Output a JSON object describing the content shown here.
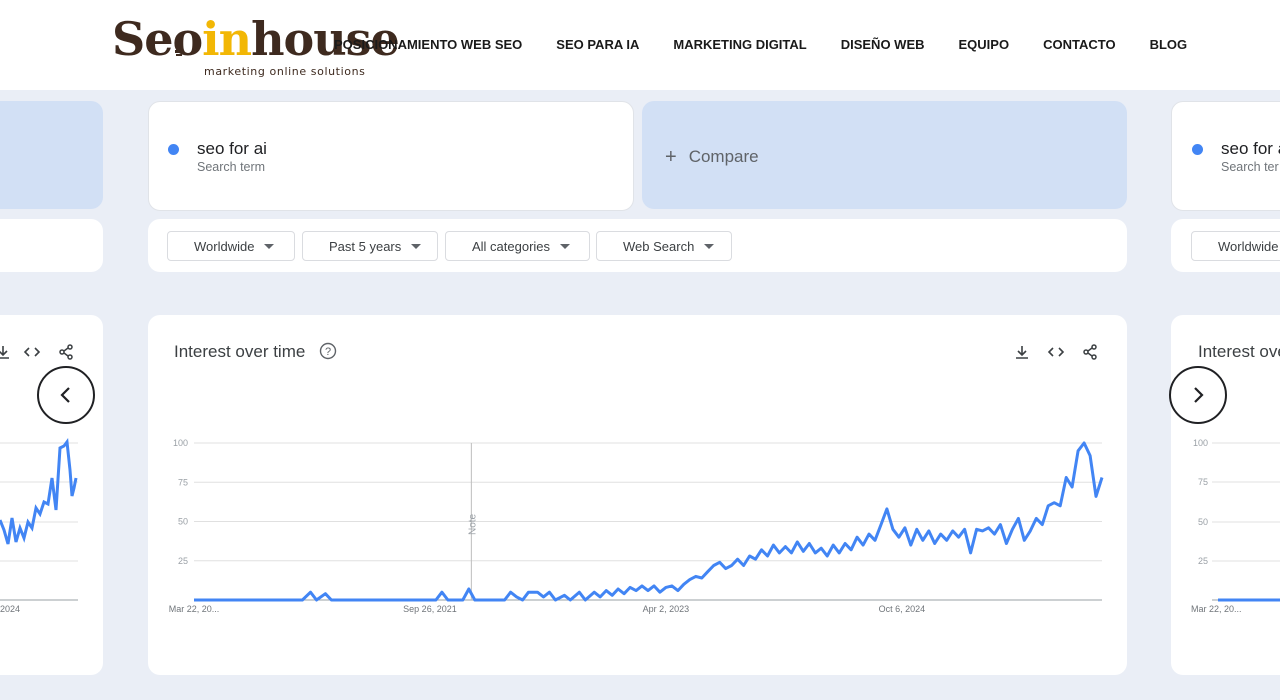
{
  "site": {
    "logo_parts": {
      "a": "Seo",
      "b": "in",
      "c": "house"
    },
    "tagline": "marketing online solutions",
    "nav": [
      {
        "label": "POSICIONAMIENTO WEB SEO"
      },
      {
        "label": "SEO PARA IA"
      },
      {
        "label": "MARKETING DIGITAL"
      },
      {
        "label": "DISEÑO WEB"
      },
      {
        "label": "EQUIPO"
      },
      {
        "label": "CONTACTO"
      },
      {
        "label": "BLOG"
      }
    ]
  },
  "trends": {
    "term": {
      "name": "seo for ai",
      "sub": "Search term",
      "color": "#4285f4"
    },
    "right_term": {
      "name": "seo for a",
      "sub": "Search ter"
    },
    "compare_label": "Compare",
    "filters": {
      "region": "Worldwide",
      "time": "Past 5 years",
      "category": "All categories",
      "search_type": "Web Search"
    },
    "right_filter": "Worldwide",
    "chart_title": "Interest over time",
    "right_chart_title": "Interest ove",
    "left_tick_label": "2024",
    "right_tick_label": "Mar 22, 20...",
    "note_label": "Note",
    "icons": {
      "help": "help-circle-icon",
      "download": "download-icon",
      "embed": "embed-code-icon",
      "share": "share-icon",
      "prev": "chevron-left-icon",
      "next": "chevron-right-icon"
    }
  },
  "chart_data": {
    "type": "line",
    "title": "Interest over time",
    "series": [
      {
        "name": "seo for ai",
        "color": "#4285f4"
      }
    ],
    "ylim": [
      0,
      100
    ],
    "yticks": [
      25,
      50,
      75,
      100
    ],
    "xlim": [
      "2020-03-22",
      "2025-03-16"
    ],
    "xtick_labels": [
      {
        "date": "2020-03-22",
        "label": "Mar 22, 20..."
      },
      {
        "date": "2021-09-26",
        "label": "Sep 26, 2021"
      },
      {
        "date": "2023-04-02",
        "label": "Apr 2, 2023"
      },
      {
        "date": "2024-10-06",
        "label": "Oct 6, 2024"
      }
    ],
    "note_date": "2022-01-01",
    "points": [
      [
        "2020-03-22",
        0
      ],
      [
        "2020-09-01",
        0
      ],
      [
        "2020-12-01",
        0
      ],
      [
        "2020-12-20",
        5
      ],
      [
        "2021-01-03",
        0
      ],
      [
        "2021-01-24",
        4
      ],
      [
        "2021-02-07",
        0
      ],
      [
        "2021-06-01",
        0
      ],
      [
        "2021-10-10",
        0
      ],
      [
        "2021-10-24",
        5
      ],
      [
        "2021-11-07",
        0
      ],
      [
        "2021-12-12",
        0
      ],
      [
        "2021-12-26",
        7
      ],
      [
        "2022-01-09",
        0
      ],
      [
        "2022-03-20",
        0
      ],
      [
        "2022-04-03",
        5
      ],
      [
        "2022-04-17",
        2
      ],
      [
        "2022-05-01",
        0
      ],
      [
        "2022-05-15",
        5
      ],
      [
        "2022-06-05",
        5
      ],
      [
        "2022-06-19",
        2
      ],
      [
        "2022-07-03",
        5
      ],
      [
        "2022-07-17",
        0
      ],
      [
        "2022-08-07",
        3
      ],
      [
        "2022-08-21",
        0
      ],
      [
        "2022-09-11",
        5
      ],
      [
        "2022-09-25",
        0
      ],
      [
        "2022-10-16",
        5
      ],
      [
        "2022-10-30",
        2
      ],
      [
        "2022-11-13",
        6
      ],
      [
        "2022-11-27",
        3
      ],
      [
        "2022-12-11",
        7
      ],
      [
        "2022-12-25",
        4
      ],
      [
        "2023-01-08",
        8
      ],
      [
        "2023-01-22",
        6
      ],
      [
        "2023-02-05",
        9
      ],
      [
        "2023-02-19",
        6
      ],
      [
        "2023-03-05",
        9
      ],
      [
        "2023-03-19",
        5
      ],
      [
        "2023-04-02",
        8
      ],
      [
        "2023-04-16",
        9
      ],
      [
        "2023-04-30",
        6
      ],
      [
        "2023-05-14",
        10
      ],
      [
        "2023-05-28",
        13
      ],
      [
        "2023-06-11",
        15
      ],
      [
        "2023-06-25",
        14
      ],
      [
        "2023-07-09",
        18
      ],
      [
        "2023-07-23",
        22
      ],
      [
        "2023-08-06",
        24
      ],
      [
        "2023-08-20",
        20
      ],
      [
        "2023-09-03",
        22
      ],
      [
        "2023-09-17",
        26
      ],
      [
        "2023-10-01",
        22
      ],
      [
        "2023-10-15",
        28
      ],
      [
        "2023-10-29",
        26
      ],
      [
        "2023-11-12",
        32
      ],
      [
        "2023-11-26",
        28
      ],
      [
        "2023-12-10",
        35
      ],
      [
        "2023-12-24",
        30
      ],
      [
        "2024-01-07",
        34
      ],
      [
        "2024-01-21",
        30
      ],
      [
        "2024-02-04",
        37
      ],
      [
        "2024-02-18",
        31
      ],
      [
        "2024-03-03",
        36
      ],
      [
        "2024-03-17",
        30
      ],
      [
        "2024-03-31",
        33
      ],
      [
        "2024-04-14",
        28
      ],
      [
        "2024-04-28",
        35
      ],
      [
        "2024-05-12",
        30
      ],
      [
        "2024-05-26",
        36
      ],
      [
        "2024-06-09",
        32
      ],
      [
        "2024-06-23",
        40
      ],
      [
        "2024-07-07",
        35
      ],
      [
        "2024-07-21",
        42
      ],
      [
        "2024-08-04",
        38
      ],
      [
        "2024-08-18",
        48
      ],
      [
        "2024-09-01",
        58
      ],
      [
        "2024-09-15",
        45
      ],
      [
        "2024-09-29",
        40
      ],
      [
        "2024-10-13",
        46
      ],
      [
        "2024-10-27",
        35
      ],
      [
        "2024-11-10",
        45
      ],
      [
        "2024-11-24",
        38
      ],
      [
        "2024-12-08",
        44
      ],
      [
        "2024-12-22",
        36
      ],
      [
        "2025-01-05",
        42
      ],
      [
        "2025-01-19",
        38
      ],
      [
        "2025-02-02",
        44
      ],
      [
        "2025-02-16",
        40
      ],
      [
        "2025-03-02",
        45
      ],
      [
        "2025-03-16",
        30
      ],
      [
        "2025-03-30",
        45
      ],
      [
        "2025-04-13",
        44
      ],
      [
        "2025-04-27",
        46
      ],
      [
        "2025-05-11",
        42
      ],
      [
        "2025-05-25",
        48
      ],
      [
        "2025-06-08",
        36
      ],
      [
        "2025-06-22",
        45
      ],
      [
        "2025-07-06",
        52
      ],
      [
        "2025-07-20",
        38
      ],
      [
        "2025-08-03",
        44
      ],
      [
        "2025-08-17",
        52
      ],
      [
        "2025-08-31",
        48
      ],
      [
        "2025-09-14",
        60
      ],
      [
        "2025-09-28",
        62
      ],
      [
        "2025-10-12",
        60
      ],
      [
        "2025-10-26",
        78
      ],
      [
        "2025-11-09",
        72
      ],
      [
        "2025-11-23",
        95
      ],
      [
        "2025-12-07",
        100
      ],
      [
        "2025-12-21",
        92
      ],
      [
        "2026-01-04",
        66
      ],
      [
        "2026-01-18",
        78
      ]
    ]
  }
}
